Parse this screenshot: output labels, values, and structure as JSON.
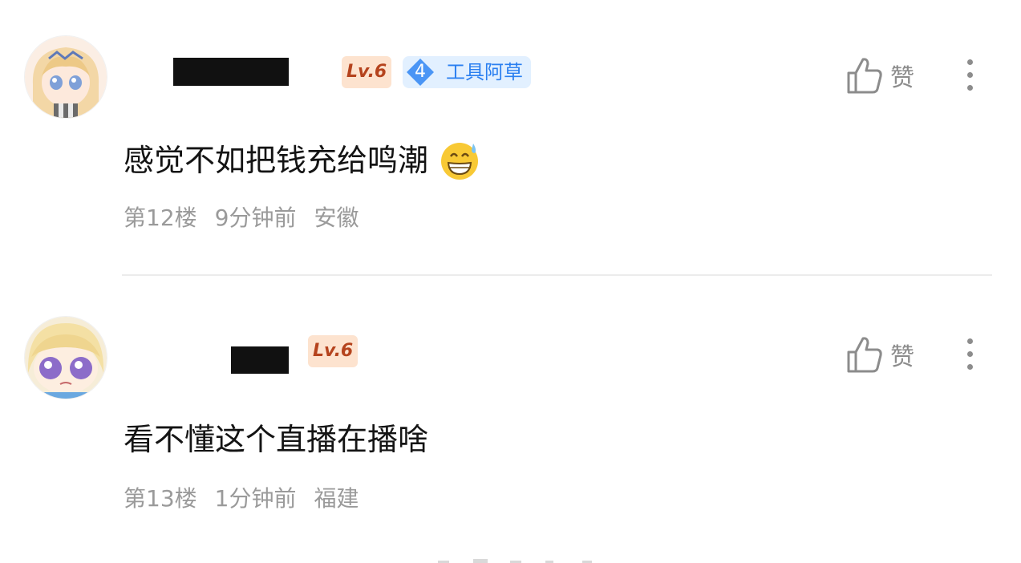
{
  "comments": [
    {
      "level_badge": "Lv.6",
      "role_badge": {
        "number": "4",
        "label": "工具阿草",
        "color": "#2a7ff0"
      },
      "like_label": "赞",
      "content": "感觉不如把钱充给鸣潮",
      "emoji": "grinning-sweat-emoji",
      "floor": "第12楼",
      "time": "9分钟前",
      "location": "安徽"
    },
    {
      "level_badge": "Lv.6",
      "like_label": "赞",
      "content": "看不懂这个直播在播啥",
      "floor": "第13楼",
      "time": "1分钟前",
      "location": "福建"
    }
  ],
  "colors": {
    "level_badge_bg": "#fde3cf",
    "level_badge_text": "#b5431d",
    "role_badge_bg": "#e2f0ff",
    "meta_text": "#9a9a9a",
    "icon_gray": "#8c8c8c"
  }
}
